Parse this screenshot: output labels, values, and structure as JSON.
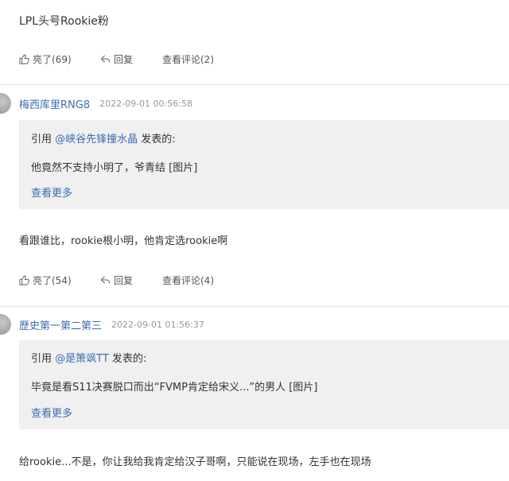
{
  "top_comment": {
    "text": "LPL头号Rookie粉"
  },
  "actions_1": {
    "like": "亮了(69)",
    "reply": "回复",
    "view": "查看评论(2)"
  },
  "post_1": {
    "author": "梅西库里RNG8",
    "time": "2022-09-01 00:56:58",
    "quote": {
      "prefix": "引用 ",
      "at": "@峡谷先锋撞水晶",
      "suffix": " 发表的:",
      "content": "他竟然不支持小明了，爷青结 [图片]",
      "more": "查看更多"
    },
    "body": "看跟谁比，rookie根小明，他肯定选rookie啊",
    "actions": {
      "like": "亮了(54)",
      "reply": "回复",
      "view": "查看评论(4)"
    }
  },
  "post_2": {
    "author": "歷史第一第二第三",
    "time": "2022-09-01 01:56:37",
    "quote": {
      "prefix": "引用 ",
      "at": "@是箫飒TT",
      "suffix": " 发表的:",
      "content": "毕竟是看S11决赛脱口而出“FVMP肯定给宋义...”的男人 [图片]",
      "more": "查看更多"
    },
    "body": "给rookie...不是，你让我给我肯定给汉子哥啊，只能说在现场，左手也在现场"
  },
  "icons": {
    "like": "thumb-up-icon",
    "reply": "reply-arrow-icon"
  }
}
